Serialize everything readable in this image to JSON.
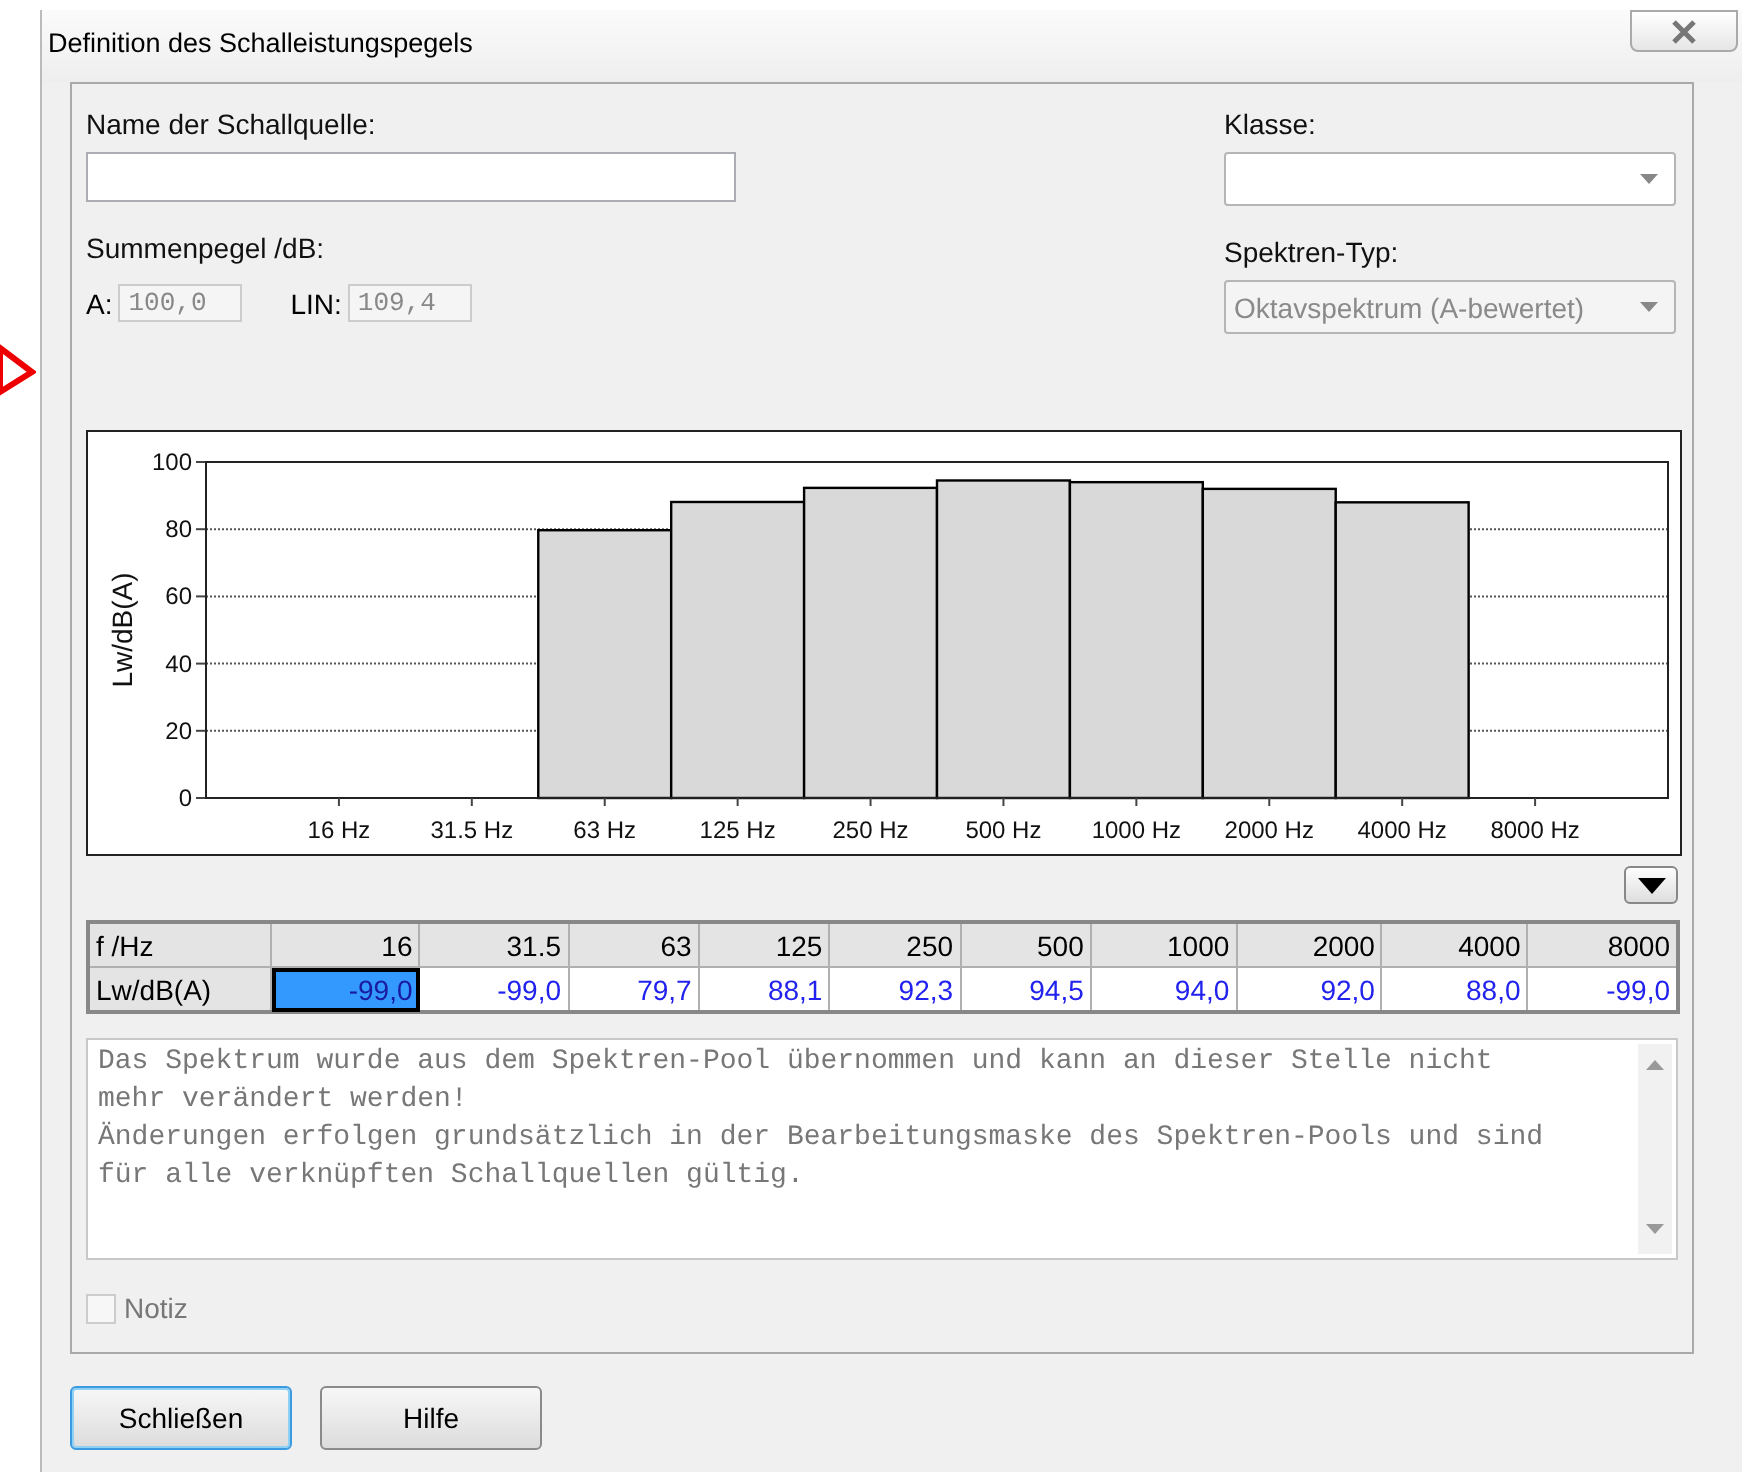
{
  "window": {
    "title": "Definition des Schalleistungspegels"
  },
  "name_field": {
    "label": "Name der Schallquelle:"
  },
  "class_field": {
    "label": "Klasse:"
  },
  "total_level": {
    "label": "Summenpegel /dB:",
    "fields": [
      {
        "label": "A:",
        "value": "100,0",
        "disabled": true
      },
      {
        "label": "LIN:",
        "value": "109,4",
        "disabled": true
      }
    ]
  },
  "spectrum_type": {
    "label": "Spektren-Typ:",
    "value": "Oktavspektrum (A-bewertet)",
    "disabled": true
  },
  "chart": {
    "chart_data": {
      "type": "bar",
      "ylabel": "Lw/dB(A)",
      "categories": [
        "16 Hz",
        "31.5 Hz",
        "63 Hz",
        "125 Hz",
        "250 Hz",
        "500 Hz",
        "1000 Hz",
        "2000 Hz",
        "4000 Hz",
        "8000 Hz"
      ],
      "series": [
        {
          "color": "#d9d9d9",
          "values": [
            null,
            null,
            79.7,
            88.1,
            92.3,
            94.5,
            94,
            92,
            88,
            null
          ]
        }
      ],
      "ylim": [
        0,
        100
      ],
      "yticks": [
        0,
        20,
        40,
        60,
        80,
        100
      ],
      "grid": true
    }
  },
  "table": {
    "columns": [
      {
        "label": "f /Hz"
      },
      {
        "label": "16"
      },
      {
        "label": "31.5"
      },
      {
        "label": "63"
      },
      {
        "label": "125"
      },
      {
        "label": "250"
      },
      {
        "label": "500"
      },
      {
        "label": "1000"
      },
      {
        "label": "2000"
      },
      {
        "label": "4000"
      },
      {
        "label": "8000"
      }
    ],
    "rows": [
      {
        "cells": [
          {
            "value": "Lw/dB(A)",
            "kind": "header",
            "selected": false
          },
          {
            "value": "-99,0",
            "selected": true
          },
          {
            "value": "-99,0",
            "selected": false
          },
          {
            "value": "79,7",
            "selected": false
          },
          {
            "value": "88,1",
            "selected": false
          },
          {
            "value": "92,3",
            "selected": false
          },
          {
            "value": "94,5",
            "selected": false
          },
          {
            "value": "94,0",
            "selected": false
          },
          {
            "value": "92,0",
            "selected": false
          },
          {
            "value": "88,0",
            "selected": false
          },
          {
            "value": "-99,0",
            "selected": false
          }
        ]
      }
    ]
  },
  "note_text": {
    "text": "Das Spektrum wurde aus dem Spektren-Pool übernommen und kann an dieser Stelle nicht\nmehr verändert werden!\nÄnderungen erfolgen grundsätzlich in der Bearbeitungsmaske des Spektren-Pools und sind\nfür alle verknüpften Schallquellen gültig."
  },
  "notiz": {
    "label": "Notiz",
    "checked": false,
    "disabled": true
  },
  "buttons": [
    {
      "label": "Schließen",
      "default": true
    },
    {
      "label": "Hilfe",
      "default": false
    }
  ]
}
